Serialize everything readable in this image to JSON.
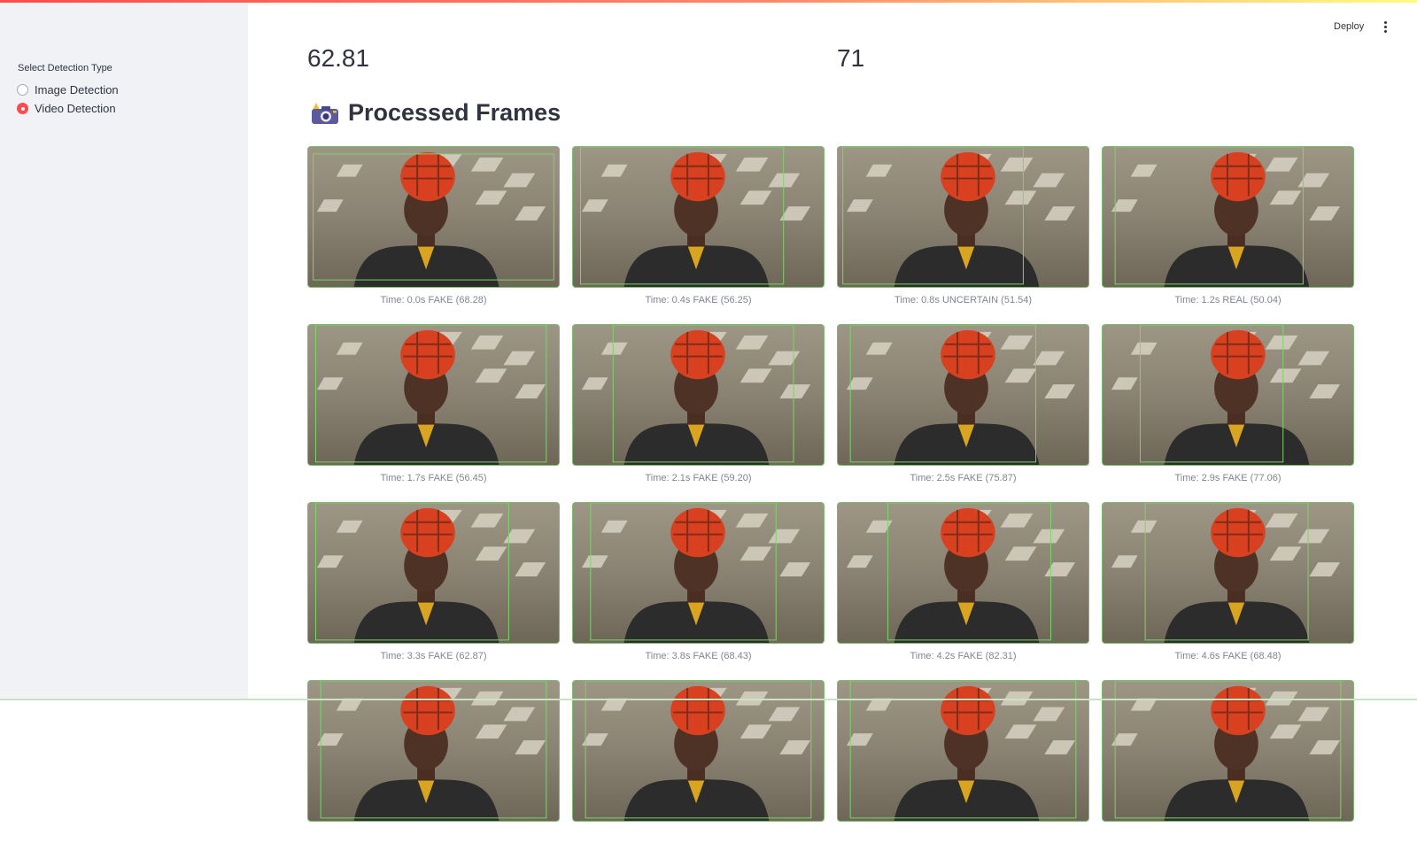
{
  "sidebar": {
    "radio_label": "Select Detection Type",
    "options": [
      {
        "label": "Image Detection",
        "selected": false
      },
      {
        "label": "Video Detection",
        "selected": true
      }
    ]
  },
  "header": {
    "deploy_label": "Deploy",
    "menu_icon": "more-vertical-icon"
  },
  "metrics": [
    {
      "value": "62.81"
    },
    {
      "value": "71"
    }
  ],
  "section": {
    "icon": "camera-icon",
    "title": "Processed Frames"
  },
  "frames": [
    {
      "caption": "Time: 0.0s FAKE (68.28)"
    },
    {
      "caption": "Time: 0.4s FAKE (56.25)"
    },
    {
      "caption": "Time: 0.8s UNCERTAIN (51.54)"
    },
    {
      "caption": "Time: 1.2s REAL (50.04)"
    },
    {
      "caption": "Time: 1.7s FAKE (56.45)"
    },
    {
      "caption": "Time: 2.1s FAKE (59.20)"
    },
    {
      "caption": "Time: 2.5s FAKE (75.87)"
    },
    {
      "caption": "Time: 2.9s FAKE (77.06)"
    },
    {
      "caption": "Time: 3.3s FAKE (62.87)"
    },
    {
      "caption": "Time: 3.8s FAKE (68.43)"
    },
    {
      "caption": "Time: 4.2s FAKE (82.31)"
    },
    {
      "caption": "Time: 4.6s FAKE (68.48)"
    },
    {
      "caption": ""
    },
    {
      "caption": ""
    },
    {
      "caption": ""
    },
    {
      "caption": ""
    }
  ],
  "colors": {
    "accent": "#ff4b4b",
    "sidebar_bg": "#f0f2f6",
    "face_box": "#7cb86f",
    "text": "#31333f",
    "caption": "#808495"
  }
}
